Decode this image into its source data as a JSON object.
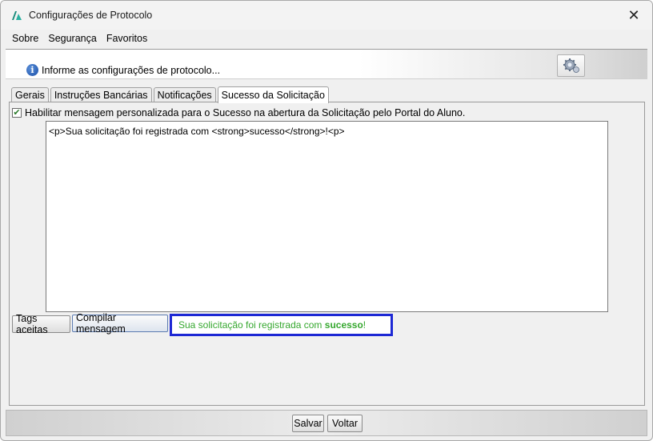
{
  "window": {
    "title": "Configurações de Protocolo",
    "close_glyph": "✕"
  },
  "menu": {
    "items": [
      "Sobre",
      "Segurança",
      "Favoritos"
    ]
  },
  "header": {
    "info_text": "Informe as configurações de protocolo..."
  },
  "tabs": [
    {
      "label": "Gerais",
      "active": false
    },
    {
      "label": "Instruções Bancárias",
      "active": false
    },
    {
      "label": "Notificações",
      "active": false
    },
    {
      "label": "Sucesso da Solicitação",
      "active": true
    }
  ],
  "panel": {
    "checkbox_label": "Habilitar mensagem personalizada para o Sucesso na abertura da Solicitação pelo Portal do Aluno.",
    "checkbox_checked": true,
    "editor_value": "<p>Sua solicitação foi registrada com <strong>sucesso</strong>!<p>",
    "tags_button": "Tags aceitas",
    "compile_button": "Compilar mensagem",
    "preview": {
      "before": "Sua solicitação foi registrada com ",
      "bold": "sucesso",
      "after": "!"
    }
  },
  "footer": {
    "save_label": "Salvar",
    "back_label": "Voltar"
  },
  "colors": {
    "preview_border": "#1d28d4",
    "preview_text": "#36a82f",
    "info_icon": "#1a4fa8"
  },
  "icons": [
    "app-logo-icon",
    "close-icon",
    "info-icon",
    "gear-icon",
    "checkmark-icon"
  ]
}
